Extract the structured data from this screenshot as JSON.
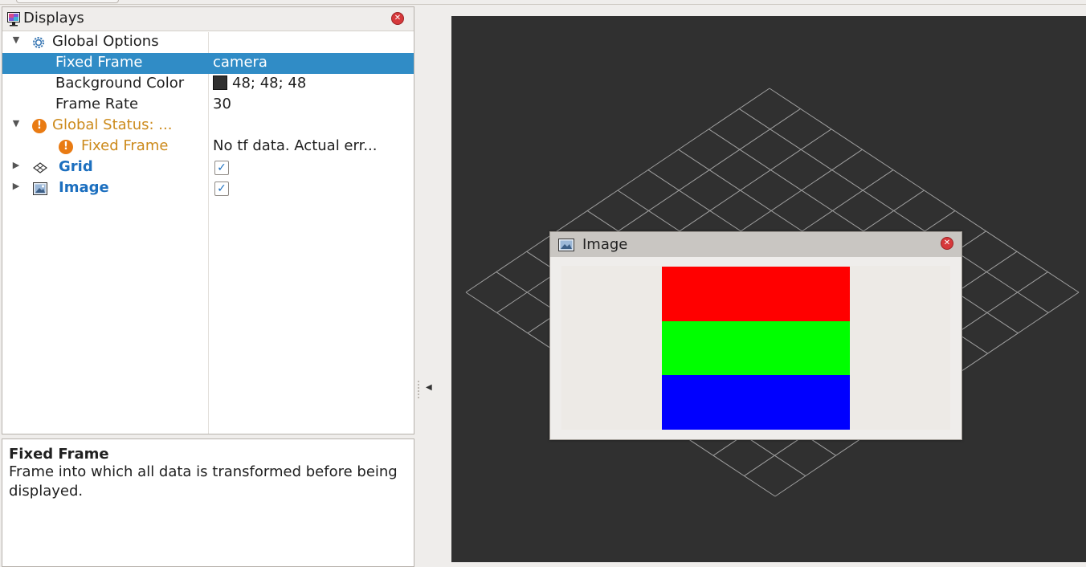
{
  "displays_panel": {
    "title": "Displays",
    "rows": [
      {
        "name": "Global Options",
        "value": ""
      },
      {
        "name": "Fixed Frame",
        "value": "camera"
      },
      {
        "name": "Background Color",
        "value": "48; 48; 48"
      },
      {
        "name": "Frame Rate",
        "value": "30"
      },
      {
        "name": "Global Status: ...",
        "value": ""
      },
      {
        "name": "Fixed Frame",
        "value": "No tf data.  Actual err..."
      },
      {
        "name": "Grid",
        "value": "",
        "checked": true
      },
      {
        "name": "Image",
        "value": "",
        "checked": true
      }
    ],
    "icons": [
      "monitor-icon",
      "gear-icon",
      "warning-icon",
      "grid-icon",
      "picture-icon",
      "close-icon",
      "expand-arrow-icon",
      "collapse-arrow-icon"
    ]
  },
  "description": {
    "title": "Fixed Frame",
    "body": "Frame into which all data is transformed before being displayed."
  },
  "image_window": {
    "title": "Image",
    "stripe_colors": [
      "#ff0000",
      "#00ff00",
      "#0000ff"
    ]
  },
  "colors": {
    "selection": "#308cc6",
    "warning": "#cc8a1b",
    "link": "#1c6fbf",
    "viewport_background": "#303030",
    "grid_line": "#a0a0a0"
  }
}
